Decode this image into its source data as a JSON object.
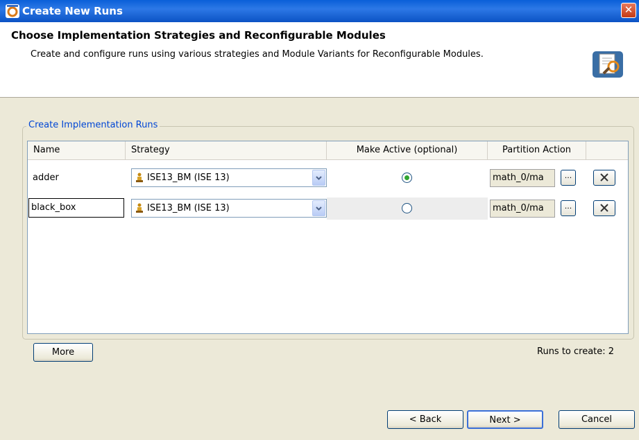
{
  "window": {
    "title": "Create New Runs",
    "close_label": "✕"
  },
  "banner": {
    "heading": "Choose Implementation Strategies and Reconfigurable Modules",
    "description": "Create and configure runs using various strategies and Module Variants for Reconfigurable Modules.",
    "icon": "wizard-icon"
  },
  "group": {
    "label": "Create Implementation Runs"
  },
  "table": {
    "columns": [
      "Name",
      "Strategy",
      "Make Active (optional)",
      "Partition Action",
      ""
    ],
    "rows": [
      {
        "name": "adder",
        "strategy": "ISE13_BM (ISE 13)",
        "active": true,
        "partition": "math_0/ma",
        "editing": false
      },
      {
        "name": "black_box",
        "strategy": "ISE13_BM (ISE 13)",
        "active": false,
        "partition": "math_0/ma",
        "editing": true
      }
    ],
    "ellipsis_label": "...",
    "delete_icon": "close-icon"
  },
  "buttons": {
    "more": "More",
    "back": "< Back",
    "next": "Next >",
    "cancel": "Cancel"
  },
  "runs_to_create": "Runs to create: 2",
  "colors": {
    "titlebar": "#0a5fd8",
    "group_label": "#0046d5",
    "radio_selected": "#31a531"
  }
}
